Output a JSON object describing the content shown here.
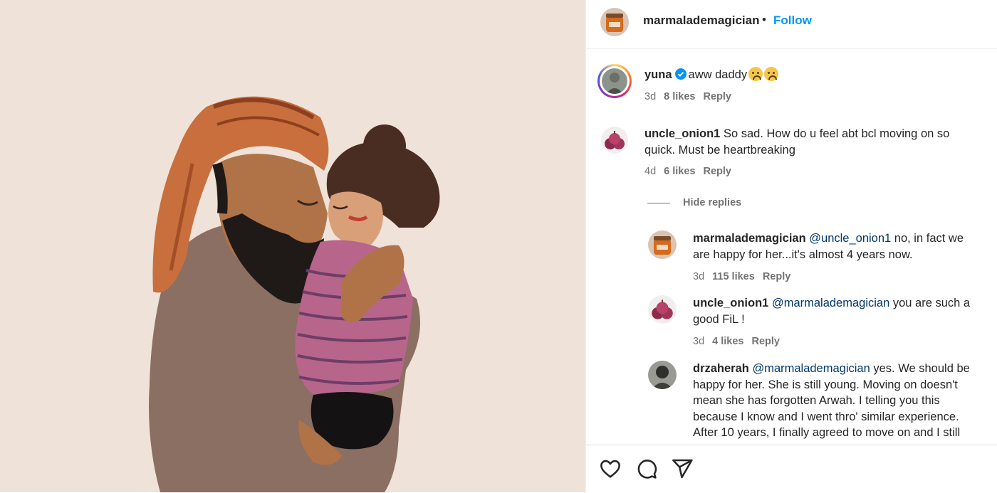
{
  "post": {
    "author": "marmalademagician",
    "separator": "•",
    "follow_label": "Follow"
  },
  "comments": [
    {
      "username": "yuna",
      "verified": true,
      "text": "aww daddy",
      "emoji": "worried-face",
      "age": "3d",
      "likes": "8 likes",
      "reply_label": "Reply"
    },
    {
      "username": "uncle_onion1",
      "text_line1": "So sad. How do u feel abt bcl moving on so",
      "text_line2": "quick. Must be heartbreaking",
      "age": "4d",
      "likes": "6 likes",
      "reply_label": "Reply",
      "hide_replies_label": "Hide replies",
      "replies": [
        {
          "username": "marmalademagician",
          "mention": "@uncle_onion1",
          "text_line1": "no, in fact we",
          "text_line2": "are happy for her...it's almost 4 years now.",
          "age": "3d",
          "likes": "115 likes",
          "reply_label": "Reply"
        },
        {
          "username": "uncle_onion1",
          "mention": "@marmalademagician",
          "text_line1": "you are such a",
          "text_line2": "good FiL !",
          "age": "3d",
          "likes": "4 likes",
          "reply_label": "Reply"
        },
        {
          "username": "drzaherah",
          "mention": "@marmalademagician",
          "text_line1": "yes. We should be",
          "text_line2": "happy for her. She is still young. Moving on doesn't",
          "text_line3": "mean she has forgotten Arwah. I telling you this",
          "text_line4": "because I know and I went thro' similar experience.",
          "text_line5": "After 10 years, I finally agreed to move on and I still"
        }
      ]
    }
  ],
  "actions": {
    "like_icon": "heart-outline-icon",
    "comment_icon": "comment-bubble-icon",
    "share_icon": "paper-plane-icon"
  },
  "colors": {
    "accent": "#0095f6",
    "mention": "#00376b",
    "secondary_text": "#737373",
    "media_background": "#efe2d9"
  }
}
